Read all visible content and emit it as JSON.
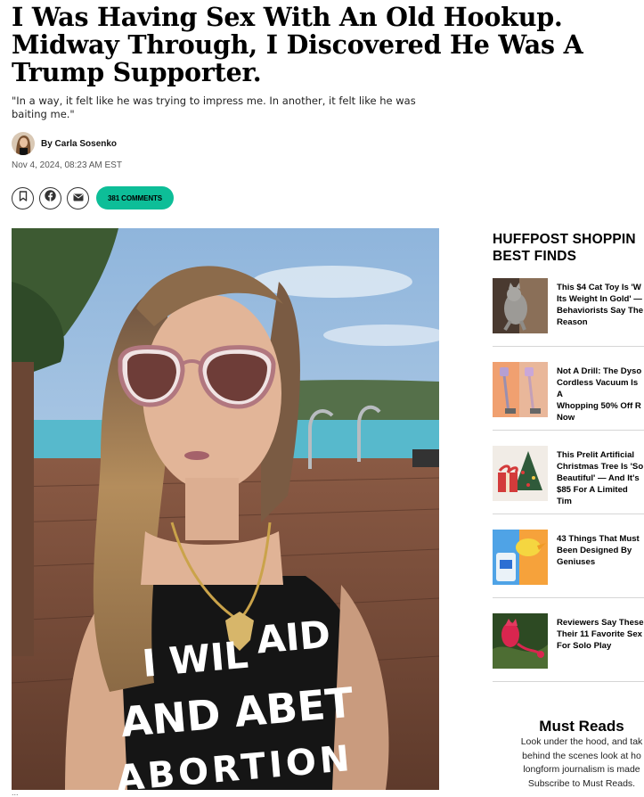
{
  "article": {
    "headline_lines": [
      "I Was Having Sex With An Old Hookup.",
      "Midway Through, I Discovered He Was A",
      "Trump Supporter."
    ],
    "dek_lines": [
      "\"In a way, it felt like he was trying to impress me. In another, it felt like he was",
      "baiting me.\""
    ],
    "author": "By Carla Sosenko",
    "timestamp": "Nov 4, 2024, 08:23 AM EST",
    "comments_label": "381 COMMENTS",
    "hero_image": {
      "shirt_text_lines": [
        "I WIL",
        "AID",
        "AND ABET",
        "ABORTION"
      ]
    },
    "caption": "..."
  },
  "icons": {
    "bookmark": "bookmark-icon",
    "facebook": "facebook-icon",
    "email": "email-icon"
  },
  "sidebar": {
    "title_lines": [
      "HUFFPOST SHOPPIN",
      "BEST FINDS"
    ],
    "items": [
      {
        "text": "This $4 Cat Toy Is 'W\nIts Weight In Gold' —\nBehaviorists Say The\nReason"
      },
      {
        "text": "Not A Drill: The Dyso\nCordless Vacuum Is A\nWhopping 50% Off R\nNow"
      },
      {
        "text": "This Prelit Artificial\nChristmas Tree Is 'So\nBeautiful' — And It's\n$85 For A Limited Tim"
      },
      {
        "text": "43 Things That Must\nBeen Designed By\nGeniuses"
      },
      {
        "text": "Reviewers Say These\nTheir 11 Favorite Sex\nFor Solo Play"
      }
    ]
  },
  "must_reads": {
    "title": "Must Reads",
    "body_lines": [
      "Look under the hood, and tak",
      "behind the scenes look at ho",
      "longform journalism is made",
      "Subscribe to Must Reads."
    ]
  },
  "colors": {
    "comments_button": "#0dbe98",
    "headline": "#000000"
  }
}
